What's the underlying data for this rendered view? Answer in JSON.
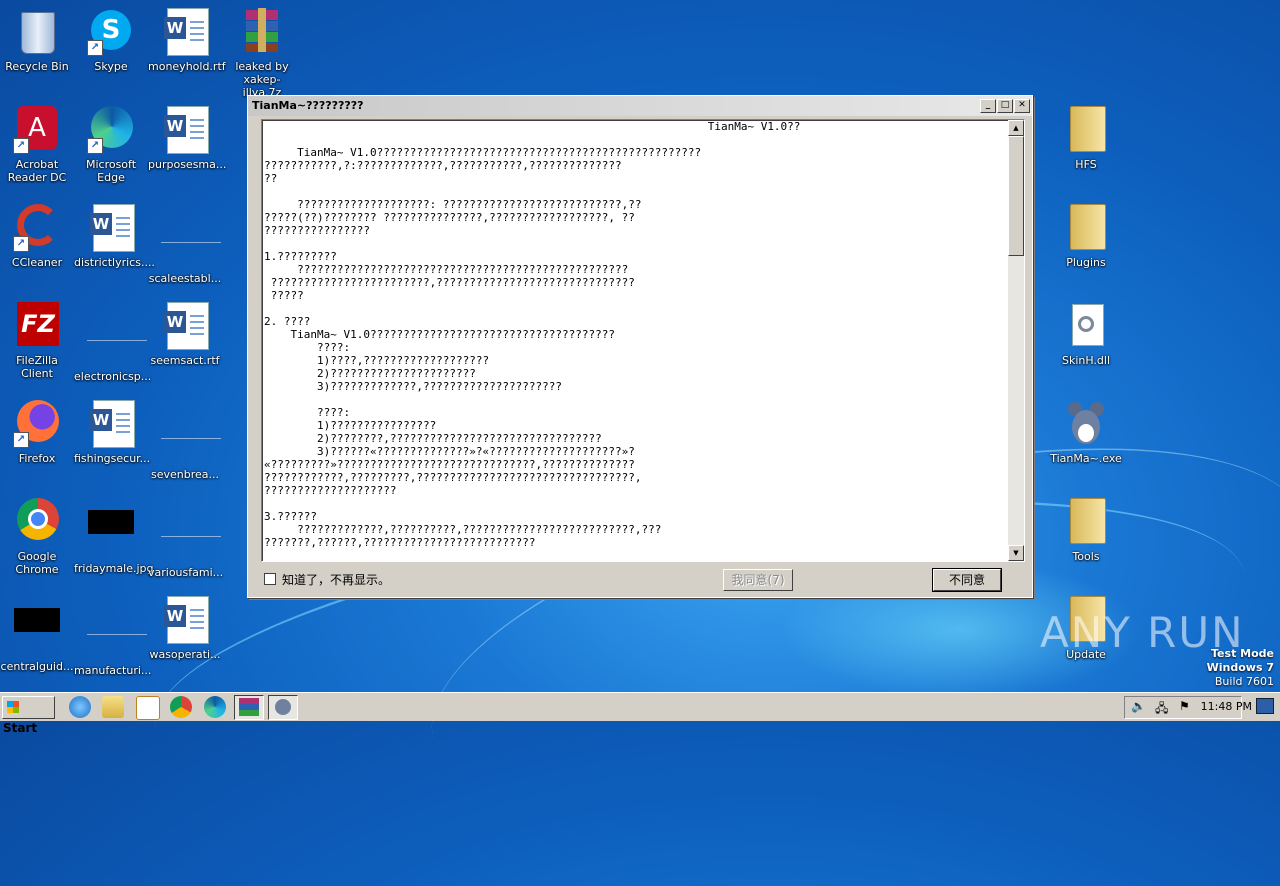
{
  "desktop": {
    "left_icons": [
      {
        "label": "Recycle Bin",
        "name": "recycle-bin"
      },
      {
        "label": "Skype",
        "name": "skype"
      },
      {
        "label": "moneyhold.rtf",
        "name": "moneyhold-rtf"
      },
      {
        "label": "leaked by xakep-illya.7z",
        "name": "leaked-7z"
      },
      {
        "label": "Acrobat Reader DC",
        "name": "acrobat-reader"
      },
      {
        "label": "Microsoft Edge",
        "name": "microsoft-edge"
      },
      {
        "label": "purposesma...",
        "name": "purposesma"
      },
      {
        "label": "CCleaner",
        "name": "ccleaner"
      },
      {
        "label": "districtlyrics....",
        "name": "districtlyrics"
      },
      {
        "label": "scaleestabl...",
        "name": "scaleestabl"
      },
      {
        "label": "FileZilla Client",
        "name": "filezilla"
      },
      {
        "label": "electronicsp...",
        "name": "electronicsp"
      },
      {
        "label": "seemsact.rtf",
        "name": "seemsact"
      },
      {
        "label": "Firefox",
        "name": "firefox"
      },
      {
        "label": "fishingsecur...",
        "name": "fishingsecur"
      },
      {
        "label": "sevenbrea...",
        "name": "sevenbrea"
      },
      {
        "label": "Google Chrome",
        "name": "google-chrome"
      },
      {
        "label": "fridaymale.jpg",
        "name": "fridaymale"
      },
      {
        "label": "variousfami...",
        "name": "variousfami"
      },
      {
        "label": "centralguid...",
        "name": "centralguid"
      },
      {
        "label": "manufacturi...",
        "name": "manufacturi"
      },
      {
        "label": "wasoperati...",
        "name": "wasoperati"
      }
    ],
    "right_icons": [
      {
        "label": "HFS",
        "name": "hfs"
      },
      {
        "label": "Plugins",
        "name": "plugins"
      },
      {
        "label": "SkinH.dll",
        "name": "skinh-dll"
      },
      {
        "label": "TianMa~.exe",
        "name": "tianma-exe"
      },
      {
        "label": "Tools",
        "name": "tools"
      },
      {
        "label": "Update",
        "name": "update"
      }
    ],
    "watermark": "ANY RUN",
    "test_mode": {
      "line1": "Test Mode",
      "line2": "Windows 7",
      "line3": "Build 7601"
    }
  },
  "dialog": {
    "title": "TianMa~?????????",
    "lines": [
      "                                                                   TianMa~ V1.0??",
      "",
      "     TianMa~ V1.0?????????????????????????????????????????????????",
      "???????????,?:?????????????,???????????,??????????????",
      "??",
      "",
      "     ????????????????????: ???????????????????????????,??",
      "?????(??)???????? ???????????????,??????????????????, ??",
      "????????????????",
      "",
      "1.?????????",
      "     ??????????????????????????????????????????????????",
      " ????????????????????????,??????????????????????????????",
      " ?????",
      "",
      "2. ????",
      "    TianMa~ V1.0?????????????????????????????????????",
      "        ????:",
      "        1)????,???????????????????",
      "        2)??????????????????????",
      "        3)?????????????,?????????????????????",
      "",
      "        ????:",
      "        1)????????????????",
      "        2)????????,????????????????????????????????",
      "        3)??????«??????????????»?«????????????????????»?",
      "«?????????»??????????????????????????????,??????????????",
      "????????????,?????????,?????????????????????????????????,",
      "????????????????????",
      "",
      "3.??????",
      "     ?????????????,??????????,??????????????????????????,???",
      "???????,??????,??????????????????????????"
    ],
    "checkbox_label": "知道了，不再显示。",
    "agree_button": "我同意(7)",
    "disagree_button": "不同意"
  },
  "taskbar": {
    "start_label": "Start",
    "clock": "11:48 PM"
  }
}
